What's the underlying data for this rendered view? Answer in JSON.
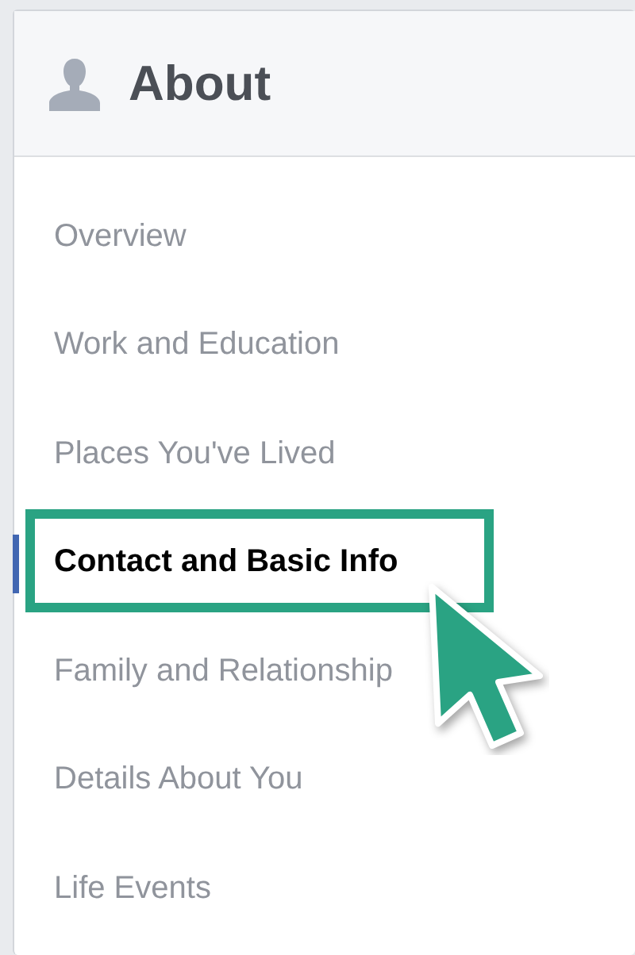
{
  "header": {
    "title": "About"
  },
  "nav_items": [
    {
      "label": "Overview",
      "selected": false
    },
    {
      "label": "Work and Education",
      "selected": false
    },
    {
      "label": "Places You've Lived",
      "selected": false
    },
    {
      "label": "Contact and Basic Info",
      "selected": true
    },
    {
      "label": "Family and Relationship",
      "selected": false
    },
    {
      "label": "Details About You",
      "selected": false
    },
    {
      "label": "Life Events",
      "selected": false
    }
  ]
}
